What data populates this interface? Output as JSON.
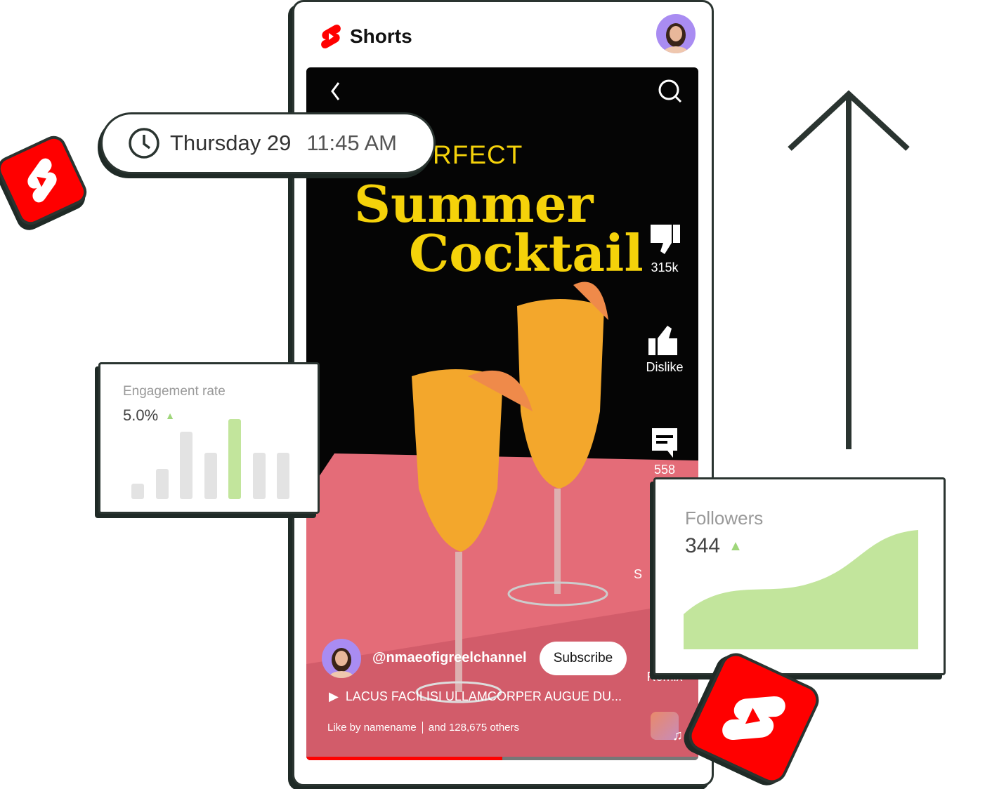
{
  "header": {
    "app_title": "Shorts",
    "logo_icon": "youtube-shorts-logo",
    "avatar_icon": "user-avatar"
  },
  "schedule": {
    "day": "Thursday 29",
    "time": "11:45 AM",
    "icon": "clock-icon"
  },
  "video": {
    "title_small": "RFECT",
    "title_line1": "Summer",
    "title_line2": "Cocktail",
    "actions": [
      {
        "icon": "thumbs-down-icon",
        "label": "315k"
      },
      {
        "icon": "thumbs-up-icon",
        "label": "Dislike"
      },
      {
        "icon": "comment-icon",
        "label": "558"
      },
      {
        "icon": "share-icon",
        "label": "S"
      },
      {
        "icon": "remix-icon",
        "label": "Remix"
      }
    ],
    "channel": "@nmaeofigreelchannel",
    "subscribe_label": "Subscribe",
    "description": "LACUS FACILISI ULLAMCORPER AUGUE DU...",
    "likes_by": "Like by namename",
    "likes_others": "and 128,675 others",
    "progress": 0.5,
    "accent": "#ff0000",
    "title_color": "#f5d20a"
  },
  "engagement": {
    "label": "Engagement rate",
    "value": "5.0%",
    "trend": "up",
    "bar_levels": [
      0.19,
      0.38,
      0.84,
      0.58,
      1.0,
      0.58,
      0.58
    ],
    "highlight_index": 4,
    "highlight_color": "#c2e59c",
    "bar_color": "#e3e3e3"
  },
  "followers": {
    "label": "Followers",
    "value": "344",
    "trend": "up",
    "area_color": "#c2e59c"
  }
}
